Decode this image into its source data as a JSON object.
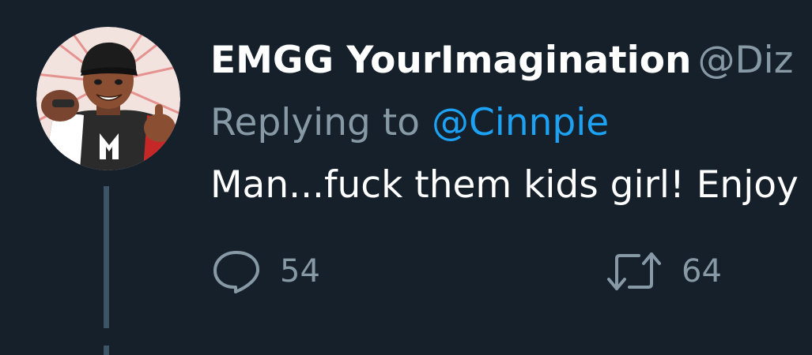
{
  "tweet": {
    "display_name": "EMGG YourImagination",
    "handle": "@Diz",
    "replying_prefix": "Replying to",
    "replying_to": "@Cinnpie",
    "text": "Man...fuck them kids girl! Enjoy"
  },
  "actions": {
    "reply_icon": "speech-bubble-icon",
    "reply_count": "54",
    "retweet_icon": "retweet-icon",
    "retweet_count": "64"
  },
  "colors": {
    "background": "#15202b",
    "name": "#ffffff",
    "secondary": "#8899a6",
    "link": "#1da1f2",
    "thread_line": "#3d5466"
  }
}
